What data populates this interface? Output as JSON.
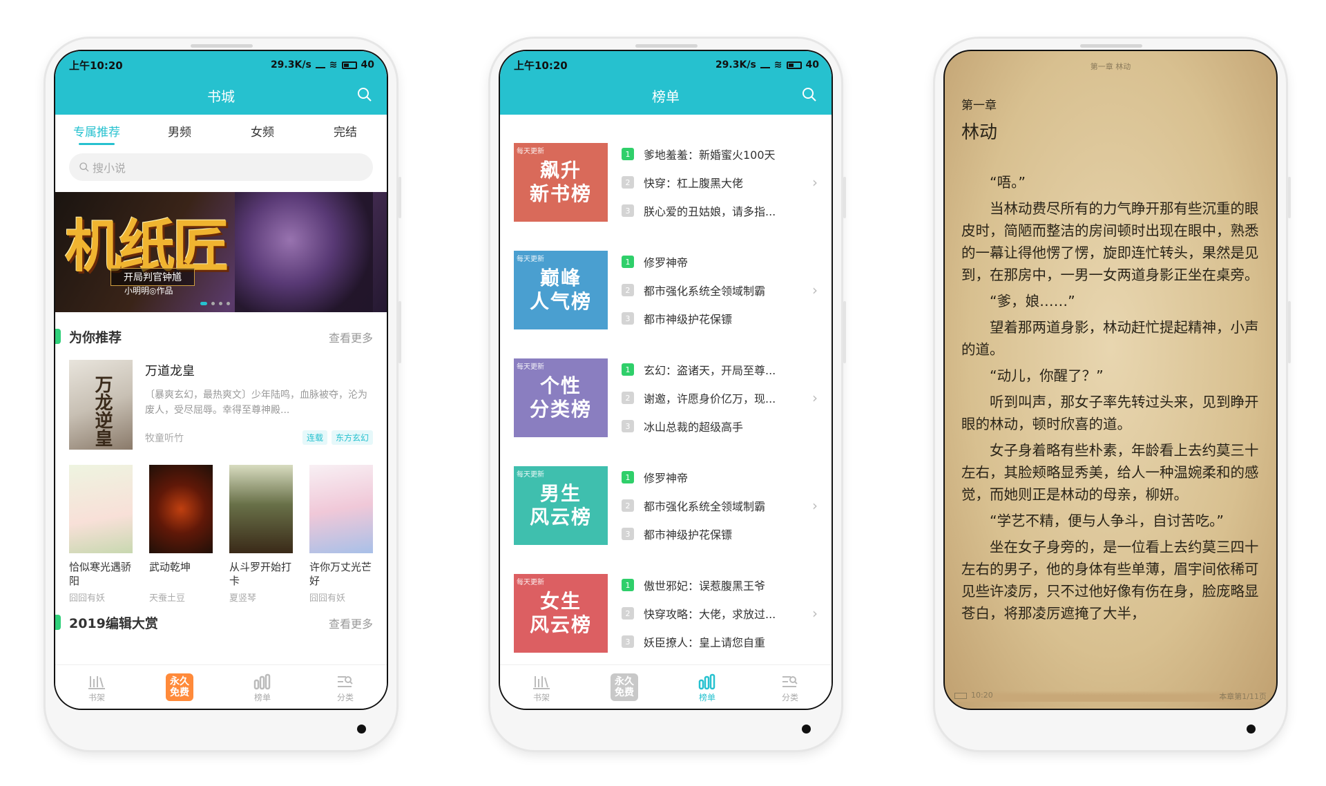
{
  "status": {
    "time": "上午10:20",
    "net": "29.3K/s",
    "battery": "40"
  },
  "bookstore": {
    "title": "书城",
    "tabs": [
      "专属推荐",
      "男频",
      "女频",
      "完结"
    ],
    "search_placeholder": "搜小说",
    "banner": {
      "title": "机纸匠",
      "tagline": "开局判官钟馗",
      "author": "小明明◎作品"
    },
    "recommend": {
      "title": "为你推荐",
      "more": "查看更多",
      "feature": {
        "name": "万道龙皇",
        "desc": "〔暴爽玄幻，最热爽文〕少年陆鸣，血脉被夺，沦为废人，受尽屈辱。幸得至尊神殿...",
        "author": "牧童听竹",
        "tags": [
          "连载",
          "东方玄幻"
        ]
      },
      "books": [
        {
          "name": "恰似寒光遇骄阳",
          "author": "囧囧有妖"
        },
        {
          "name": "武动乾坤",
          "author": "天蚕土豆"
        },
        {
          "name": "从斗罗开始打卡",
          "author": "夏竖琴"
        },
        {
          "name": "许你万丈光芒好",
          "author": "囧囧有妖"
        }
      ]
    },
    "section2": {
      "title": "2019编辑大赏",
      "more": "查看更多"
    }
  },
  "nav": [
    {
      "label": "书架",
      "icon": "bookshelf-icon"
    },
    {
      "label": "免费",
      "badge_top": "永久",
      "badge_bottom": "免费",
      "icon": "free-badge-icon"
    },
    {
      "label": "榜单",
      "icon": "ranking-icon"
    },
    {
      "label": "分类",
      "icon": "category-icon"
    }
  ],
  "ranking": {
    "title": "榜单",
    "daily": "每天更新",
    "lists": [
      {
        "title1": "飙升",
        "title2": "新书榜",
        "color": "#d96a5a",
        "items": [
          "爹地羞羞：新婚蜜火100天",
          "快穿：杠上腹黑大佬",
          "朕心爱的丑姑娘，请多指..."
        ]
      },
      {
        "title1": "巅峰",
        "title2": "人气榜",
        "color": "#4a9fd0",
        "items": [
          "修罗神帝",
          "都市强化系统全领域制霸",
          "都市神级护花保镖"
        ]
      },
      {
        "title1": "个性",
        "title2": "分类榜",
        "color": "#8a7ec0",
        "items": [
          "玄幻：盗诸天，开局至尊...",
          "谢邀，许愿身价亿万，现...",
          "冰山总裁的超级高手"
        ]
      },
      {
        "title1": "男生",
        "title2": "风云榜",
        "color": "#3fbfae",
        "items": [
          "修罗神帝",
          "都市强化系统全领域制霸",
          "都市神级护花保镖"
        ]
      },
      {
        "title1": "女生",
        "title2": "风云榜",
        "color": "#dc5f62",
        "items": [
          "傲世邪妃：误惹腹黑王爷",
          "快穿攻略：大佬，求放过...",
          "妖臣撩人：皇上请您自重"
        ]
      }
    ]
  },
  "reader": {
    "header": "第一章 林动",
    "chapter": "第一章",
    "chapter_name": "林动",
    "paragraphs": [
      "“唔。”",
      "当林动费尽所有的力气睁开那有些沉重的眼皮时，简陋而整洁的房间顿时出现在眼中，熟悉的一幕让得他愣了愣，旋即连忙转头，果然是见到，在那房中，一男一女两道身影正坐在桌旁。",
      "“爹，娘……”",
      "望着那两道身影，林动赶忙提起精神，小声的道。",
      "“动儿，你醒了？”",
      "听到叫声，那女子率先转过头来，见到睁开眼的林动，顿时欣喜的道。",
      "女子身着略有些朴素，年龄看上去约莫三十左右，其脸颊略显秀美，给人一种温婉柔和的感觉，而她则正是林动的母亲，柳妍。",
      "“学艺不精，便与人争斗，自讨苦吃。”",
      "坐在女子身旁的，是一位看上去约莫三四十左右的男子，他的身体有些单薄，眉宇间依稀可见些许凌厉，只不过他好像有伤在身，脸庞略显苍白，将那凌厉遮掩了大半，"
    ],
    "time": "10:20",
    "progress": "本章第1/11页"
  }
}
